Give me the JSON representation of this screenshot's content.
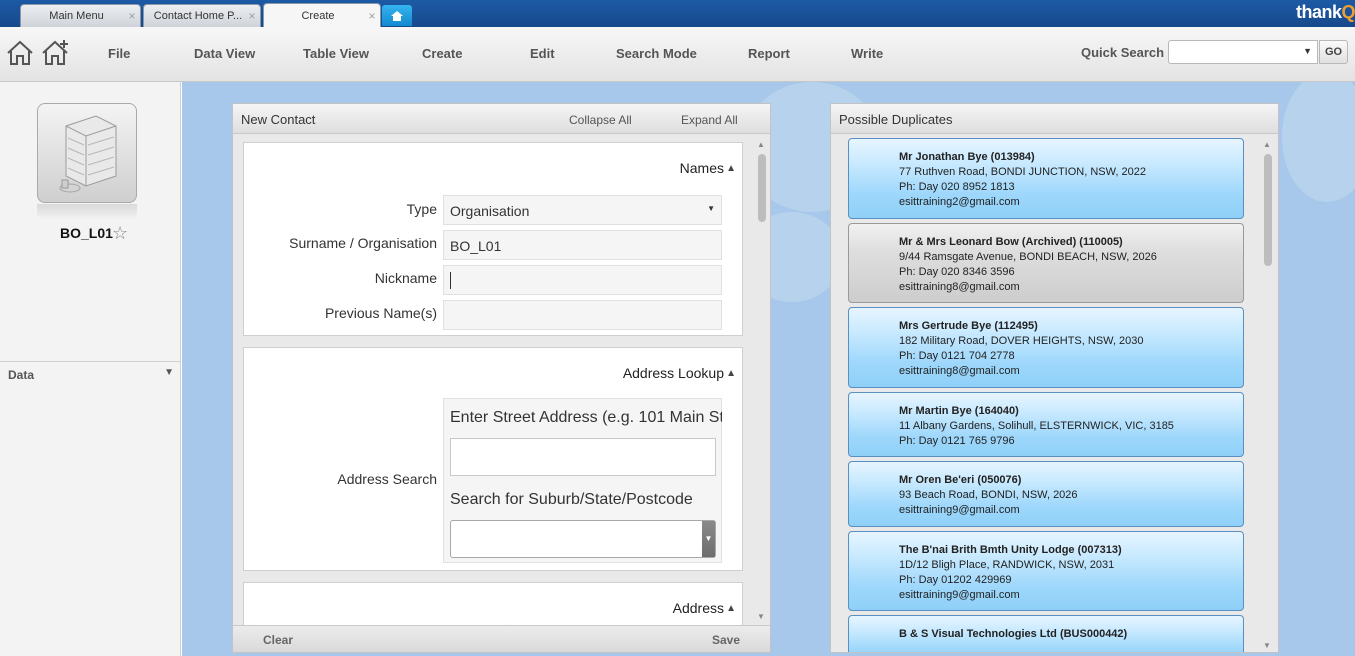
{
  "tabs": [
    {
      "label": "Main Menu",
      "close": "×"
    },
    {
      "label": "Contact Home P...",
      "close": "×"
    },
    {
      "label": "Create",
      "close": "×"
    }
  ],
  "brand": {
    "text": "thank",
    "accent": "Q"
  },
  "menu": {
    "items": [
      "File",
      "Data View",
      "Table View",
      "Create",
      "Edit",
      "Search Mode",
      "Report",
      "Write"
    ],
    "quick_search_label": "Quick Search",
    "quick_search_value": "",
    "go_label": "GO"
  },
  "left": {
    "record_name": "BO_L01",
    "data_section": "Data"
  },
  "new_contact": {
    "title": "New Contact",
    "collapse_all": "Collapse All",
    "expand_all": "Expand All",
    "clear_label": "Clear",
    "save_label": "Save",
    "names": {
      "title": "Names",
      "type_label": "Type",
      "type_value": "Organisation",
      "surname_label": "Surname / Organisation",
      "surname_value": "BO_L01",
      "nickname_label": "Nickname",
      "nickname_value": "",
      "previous_label": "Previous Name(s)",
      "previous_value": ""
    },
    "address_lookup": {
      "title": "Address Lookup",
      "search_label": "Address Search",
      "street_hint": "Enter Street Address (e.g. 101 Main St",
      "suburb_hint": "Search for Suburb/State/Postcode"
    },
    "address": {
      "title": "Address"
    }
  },
  "duplicates": {
    "title": "Possible Duplicates",
    "items": [
      {
        "name": "Mr Jonathan Bye (013984)",
        "address": "77 Ruthven Road, BONDI JUNCTION, NSW, 2022",
        "phone": "Ph:  Day 020 8952 1813",
        "email": "esittraining2@gmail.com",
        "archived": false
      },
      {
        "name": "Mr & Mrs Leonard Bow (Archived) (110005)",
        "address": "9/44 Ramsgate Avenue, BONDI BEACH, NSW, 2026",
        "phone": "Ph:  Day 020 8346 3596",
        "email": "esittraining8@gmail.com",
        "archived": true
      },
      {
        "name": "Mrs Gertrude Bye (112495)",
        "address": "182 Military Road, DOVER HEIGHTS, NSW, 2030",
        "phone": "Ph:  Day 0121 704 2778",
        "email": "esittraining8@gmail.com",
        "archived": false
      },
      {
        "name": "Mr Martin Bye (164040)",
        "address": "11 Albany Gardens, Solihull, ELSTERNWICK, VIC, 3185",
        "phone": "Ph:  Day 0121 765 9796",
        "email": "",
        "archived": false
      },
      {
        "name": "Mr Oren Be'eri (050076)",
        "address": "93 Beach Road, BONDI, NSW, 2026",
        "phone": "",
        "email": "esittraining9@gmail.com",
        "archived": false
      },
      {
        "name": "The B'nai Brith Bmth Unity Lodge (007313)",
        "address": "1D/12 Bligh Place, RANDWICK, NSW, 2031",
        "phone": "Ph:  Day 01202 429969",
        "email": "esittraining9@gmail.com",
        "archived": false
      },
      {
        "name": "B & S Visual Technologies Ltd (BUS000442)",
        "address": "",
        "phone": "",
        "email": "",
        "archived": false
      }
    ]
  }
}
